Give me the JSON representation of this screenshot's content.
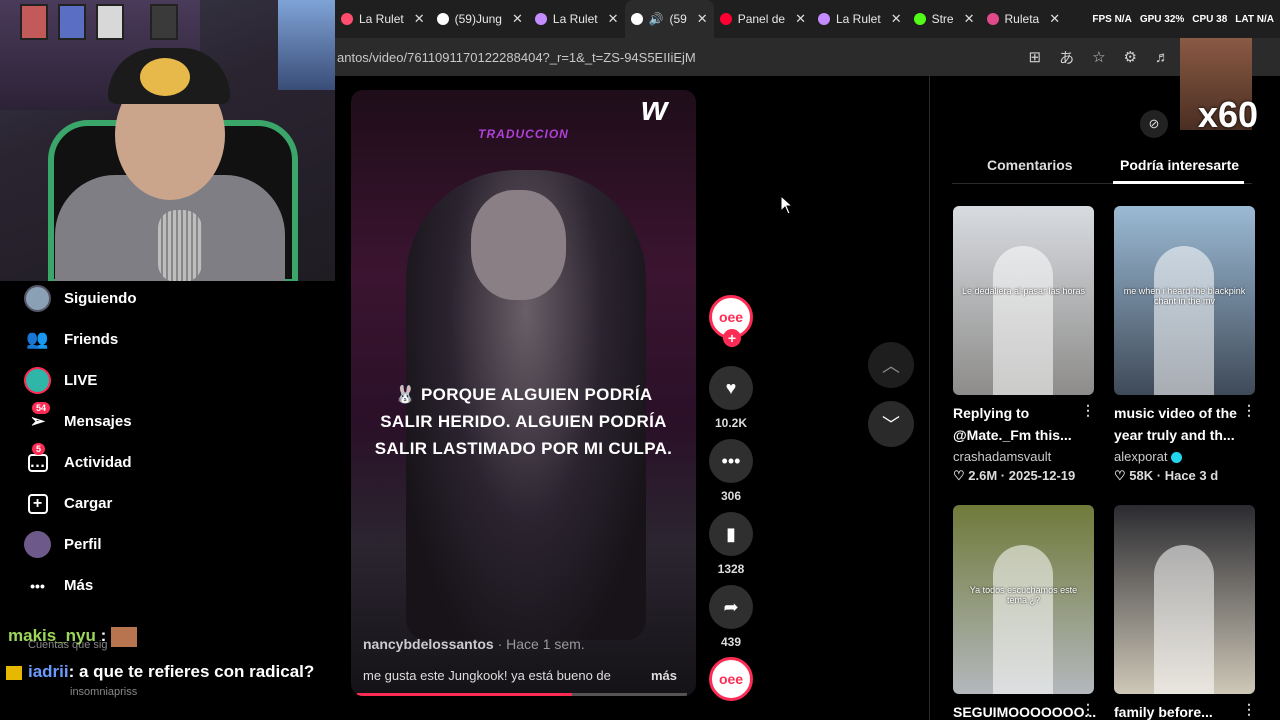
{
  "browser": {
    "tabs": [
      {
        "title": "La Rulet",
        "color": "#ff4d6d",
        "active": false
      },
      {
        "title": "(59)Jung",
        "color": "#ffffff",
        "active": false
      },
      {
        "title": "La Rulet",
        "color": "#c58cff",
        "active": false
      },
      {
        "title": "(59",
        "color": "#ffffff",
        "active": true
      },
      {
        "title": "Panel de",
        "color": "#ff0033",
        "active": false
      },
      {
        "title": "La Rulet",
        "color": "#c58cff",
        "active": false
      },
      {
        "title": "Stre",
        "color": "#53fc18",
        "active": false
      },
      {
        "title": "Ruleta",
        "color": "#e04a8a",
        "active": false
      }
    ],
    "url": "antos/video/7611091170122288404?_r=1&_t=ZS-94S5EIIiEjM",
    "hud": {
      "fps": "FPS N/A",
      "gpu": "GPU 32%",
      "cpu": "CPU 38",
      "lat": "LAT N/A"
    }
  },
  "sidebar": {
    "items": [
      {
        "label": "Siguiendo",
        "icon": "following-avatar-icon",
        "badge": ""
      },
      {
        "label": "Friends",
        "icon": "friends-icon",
        "badge": ""
      },
      {
        "label": "LIVE",
        "icon": "live-icon",
        "badge": ""
      },
      {
        "label": "Mensajes",
        "icon": "messages-icon",
        "badge": "54"
      },
      {
        "label": "Actividad",
        "icon": "activity-icon",
        "badge": "5"
      },
      {
        "label": "Cargar",
        "icon": "upload-icon",
        "badge": ""
      },
      {
        "label": "Perfil",
        "icon": "profile-avatar-icon",
        "badge": ""
      },
      {
        "label": "Más",
        "icon": "more-icon",
        "badge": ""
      }
    ],
    "ghost_text_1": "Cuentas que sig",
    "ghost_text_2": "insomniapriss"
  },
  "chat": {
    "line1_user": "makis_nyu",
    "line1_sep": ":",
    "line2_user": "iadrii",
    "line2_text": ": a que te refieres con radical?"
  },
  "video": {
    "overlay_label": "TRADUCCION",
    "logo": "w",
    "caption_lines": [
      "🐰 PORQUE ALGUIEN PODRÍA",
      "SALIR HERIDO. ALGUIEN PODRÍA",
      "SALIR LASTIMADO POR MI CULPA."
    ],
    "author": "nancybdelossantos",
    "posted": "· Hace 1 sem.",
    "description": "me gusta este Jungkook! ya está bueno de",
    "more": "más",
    "progress": 0.65
  },
  "actions": {
    "likes": "10.2K",
    "comments": "306",
    "saves": "1328",
    "shares": "439"
  },
  "panel": {
    "tab_comments": "Comentarios",
    "tab_related": "Podría interesarte",
    "x60": "x60",
    "cards": [
      {
        "title": "Replying to @Mate._Fm this...",
        "author": "crashadamsvault",
        "likes": "2.6M",
        "date": "2025-12-19",
        "verified": false,
        "overlay": "Le dedaliera al pasar las horas",
        "topcolor": "#d8dbe0",
        "botcolor": "#8d8c8a"
      },
      {
        "title": "music video of the year truly and th...",
        "author": "alexporat",
        "likes": "58K",
        "date": "Hace 3 d",
        "verified": true,
        "overlay": "me when i heard the blackpink chant in the mv",
        "topcolor": "#9bbad4",
        "botcolor": "#3f4a58"
      },
      {
        "title": "SEGUIMOOOOOOO...",
        "author": "",
        "likes": "",
        "date": "",
        "verified": false,
        "overlay": "Ya todos escuchamos este tema ¿?",
        "topcolor": "#6f7a3a",
        "botcolor": "#b4b8bd"
      },
      {
        "title": "family before...",
        "author": "",
        "likes": "",
        "date": "",
        "verified": false,
        "overlay": "",
        "topcolor": "#2b2b30",
        "botcolor": "#cfc8b8"
      }
    ]
  }
}
